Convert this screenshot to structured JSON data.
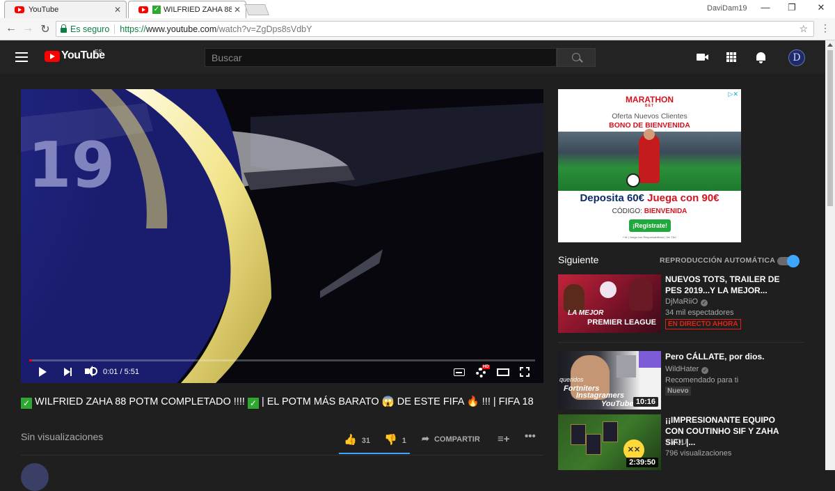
{
  "browser": {
    "tabs": [
      {
        "title": "YouTube",
        "close": "✕"
      },
      {
        "title": "WILFRIED ZAHA 88 P",
        "close": "✕"
      }
    ],
    "user": "DaviDam19",
    "window_controls": {
      "minimize": "—",
      "restore": "❐",
      "close": "✕"
    },
    "address": {
      "security_label": "Es seguro",
      "scheme": "https://",
      "host": "www.youtube.com",
      "path": "/watch?v=ZgDps8sVdbY"
    }
  },
  "masthead": {
    "logo_text": "YouTube",
    "country_code": "ES",
    "search_placeholder": "Buscar",
    "avatar_letter": "D"
  },
  "player": {
    "time": "0:01 / 5:51",
    "progress_fraction": 0.003,
    "hd_badge": "HD"
  },
  "video": {
    "title_parts": {
      "a": "WILFRIED ZAHA 88 POTM COMPLETADO !!!! ",
      "b": " | EL POTM MÁS BARATO ",
      "scream": "😱",
      "c": " DE ESTE FIFA ",
      "fire": "🔥",
      "d": " !!! | FIFA 18"
    },
    "check": "✓",
    "views": "Sin visualizaciones",
    "likes": "31",
    "dislikes": "1",
    "share_label": "COMPARTIR"
  },
  "ad": {
    "brand": "MARATHON",
    "brand_sub": "BET",
    "line1": "Oferta Nuevos Clientes",
    "line2": "BONO DE BIENVENIDA",
    "deposit": "Deposita 60€",
    "bonus": "Juega con 90€",
    "code_label": "CÓDIGO:",
    "code": "BIENVENIDA",
    "cta": "¡Regístrate!",
    "fine_print": "+18 | Juega con Responsabilidad | Ver T&C",
    "adchoices": "▷✕"
  },
  "sidebar": {
    "up_next": "Siguiente",
    "autoplay": "REPRODUCCIÓN AUTOMÁTICA",
    "autoplay_on": true,
    "items": [
      {
        "title": "NUEVOS TOTS, TRAILER DE PES 2019...Y LA MEJOR...",
        "channel": "DjMaRiiO",
        "meta": "34 mil espectadores",
        "badge": "EN DIRECTO AHORA",
        "thumb_text": "LA MEJOR",
        "thumb_text2": "PREMIER LEAGUE"
      },
      {
        "title": "Pero CÁLLATE, por dios.",
        "channel": "WildHater",
        "meta": "Recomendado para ti",
        "badge": "Nuevo",
        "duration": "10:16",
        "thumb_text": "queridos",
        "thumb_text2": "Fortniters",
        "thumb_text3": "Instagramers",
        "thumb_text4": "YouTubers"
      },
      {
        "title": "¡¡IMPRESIONANTE EQUIPO CON COUTINHO SIF Y ZAHA SIF!! |...",
        "channel": "XYOU",
        "meta": "796 visualizaciones",
        "duration": "2:39:50"
      }
    ]
  },
  "colors": {
    "page_bg": "#1f1f1f",
    "masthead_bg": "#232323",
    "accent_red": "#ff0000",
    "toggle_blue": "#3ea6ff",
    "live_red": "#e62117"
  }
}
